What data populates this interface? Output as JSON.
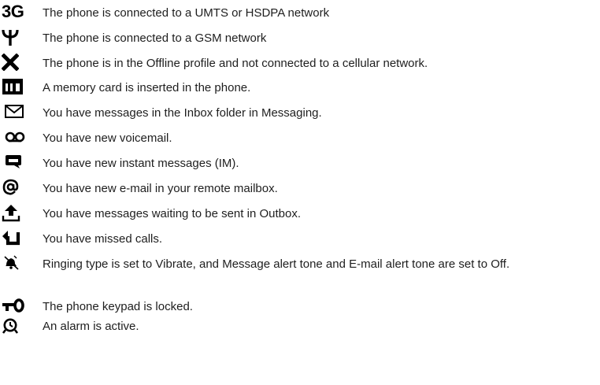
{
  "items": [
    {
      "icon": "3g-icon",
      "icon_text": "3G",
      "text": "The phone is connected to a UMTS or HSDPA network"
    },
    {
      "icon": "antenna-icon",
      "text": "The phone is connected to a GSM network"
    },
    {
      "icon": "offline-x-icon",
      "text": "The phone is in the Offline profile and not connected to a cellular network."
    },
    {
      "icon": "memory-card-icon",
      "text": "A memory card is inserted in the phone."
    },
    {
      "icon": "envelope-icon",
      "text": "You have messages in the Inbox folder in Messaging."
    },
    {
      "icon": "voicemail-icon",
      "text": "You have new voicemail."
    },
    {
      "icon": "instant-message-icon",
      "text": "You have new instant messages (IM)."
    },
    {
      "icon": "at-icon",
      "text": "You have new e-mail in your remote mailbox."
    },
    {
      "icon": "outbox-icon",
      "text": "You have messages waiting to be sent in Outbox."
    },
    {
      "icon": "missed-call-icon",
      "text": "You have missed calls."
    },
    {
      "icon": "silent-icon",
      "text": "Ringing type is set to Vibrate, and Message alert tone and E-mail alert tone are set to Off."
    },
    {
      "icon": "keypad-lock-icon",
      "text": "The phone keypad is locked."
    },
    {
      "icon": "alarm-icon",
      "text": "An alarm is active."
    }
  ]
}
